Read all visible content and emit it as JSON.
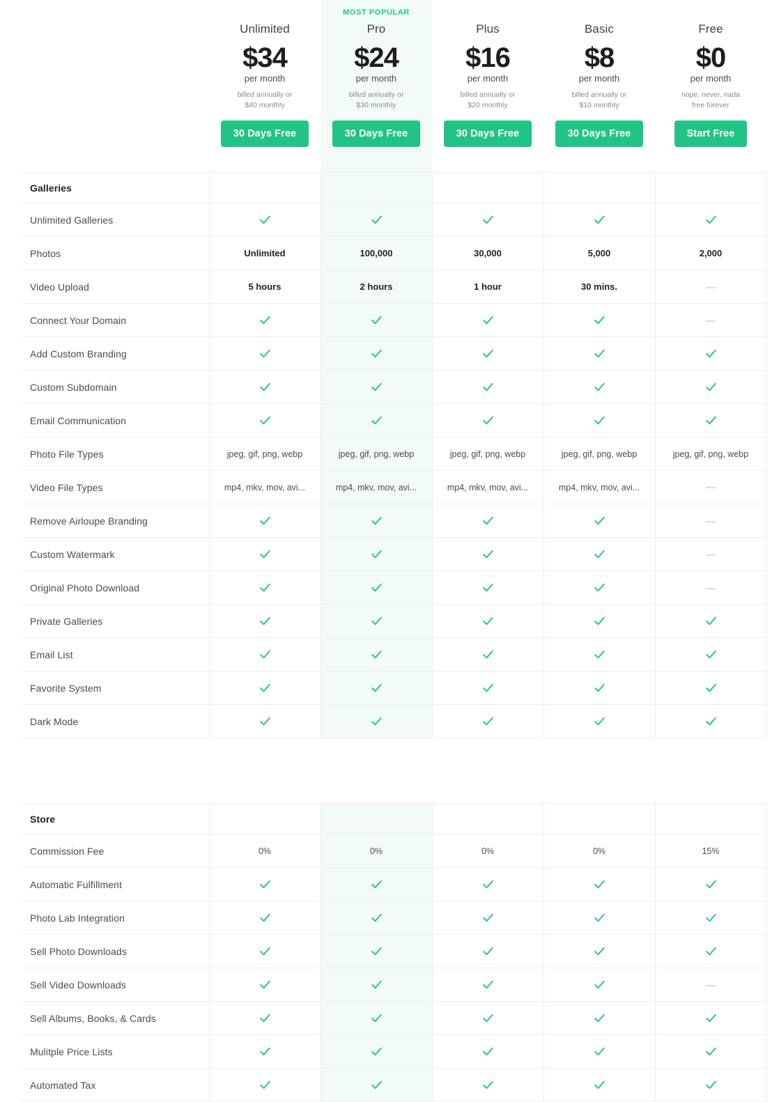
{
  "accent_color": "#22c486",
  "highlight_bg": "#f3fbf7",
  "border_color": "#ededed",
  "plans": [
    {
      "name": "Unlimited",
      "popular_label": "",
      "price": "$34",
      "per": "per month",
      "note_line1": "billed annually or",
      "note_line2": "$40 monthly",
      "cta": "30 Days Free",
      "highlight": false
    },
    {
      "name": "Pro",
      "popular_label": "MOST POPULAR",
      "price": "$24",
      "per": "per month",
      "note_line1": "billed annually or",
      "note_line2": "$30 monthly",
      "cta": "30 Days Free",
      "highlight": true
    },
    {
      "name": "Plus",
      "popular_label": "",
      "price": "$16",
      "per": "per month",
      "note_line1": "billed annually or",
      "note_line2": "$20 monthly",
      "cta": "30 Days Free",
      "highlight": false
    },
    {
      "name": "Basic",
      "popular_label": "",
      "price": "$8",
      "per": "per month",
      "note_line1": "billed annually or",
      "note_line2": "$10 monthly",
      "cta": "30 Days Free",
      "highlight": false
    },
    {
      "name": "Free",
      "popular_label": "",
      "price": "$0",
      "per": "per month",
      "note_line1": "nope, never, nada",
      "note_line2": "free forever",
      "cta": "Start Free",
      "highlight": false
    }
  ],
  "sections": [
    {
      "title": "Galleries",
      "rows": [
        {
          "label": "Unlimited Galleries",
          "values": [
            "check",
            "check",
            "check",
            "check",
            "check"
          ]
        },
        {
          "label": "Photos",
          "values": [
            "Unlimited",
            "100,000",
            "30,000",
            "5,000",
            "2,000"
          ],
          "bold": true
        },
        {
          "label": "Video Upload",
          "values": [
            "5 hours",
            "2 hours",
            "1 hour",
            "30 mins.",
            "dash"
          ],
          "bold": true
        },
        {
          "label": "Connect Your Domain",
          "values": [
            "check",
            "check",
            "check",
            "check",
            "dash"
          ]
        },
        {
          "label": "Add Custom Branding",
          "values": [
            "check",
            "check",
            "check",
            "check",
            "check"
          ]
        },
        {
          "label": "Custom Subdomain",
          "values": [
            "check",
            "check",
            "check",
            "check",
            "check"
          ]
        },
        {
          "label": "Email Communication",
          "values": [
            "check",
            "check",
            "check",
            "check",
            "check"
          ]
        },
        {
          "label": "Photo File Types",
          "values": [
            "jpeg, gif, png, webp",
            "jpeg, gif, png, webp",
            "jpeg, gif, png, webp",
            "jpeg, gif, png, webp",
            "jpeg, gif, png, webp"
          ],
          "plain": true
        },
        {
          "label": "Video File Types",
          "values": [
            "mp4, mkv, mov, avi...",
            "mp4, mkv, mov, avi...",
            "mp4, mkv, mov, avi...",
            "mp4, mkv, mov, avi...",
            "dash"
          ],
          "plain": true
        },
        {
          "label": "Remove Airloupe Branding",
          "values": [
            "check",
            "check",
            "check",
            "check",
            "dash"
          ]
        },
        {
          "label": "Custom Watermark",
          "values": [
            "check",
            "check",
            "check",
            "check",
            "dash"
          ]
        },
        {
          "label": "Original Photo Download",
          "values": [
            "check",
            "check",
            "check",
            "check",
            "dash"
          ]
        },
        {
          "label": "Private Galleries",
          "values": [
            "check",
            "check",
            "check",
            "check",
            "check"
          ]
        },
        {
          "label": "Email List",
          "values": [
            "check",
            "check",
            "check",
            "check",
            "check"
          ]
        },
        {
          "label": "Favorite System",
          "values": [
            "check",
            "check",
            "check",
            "check",
            "check"
          ]
        },
        {
          "label": "Dark Mode",
          "values": [
            "check",
            "check",
            "check",
            "check",
            "check"
          ]
        }
      ]
    },
    {
      "title": "Store",
      "rows": [
        {
          "label": "Commission Fee",
          "values": [
            "0%",
            "0%",
            "0%",
            "0%",
            "15%"
          ],
          "plain": true
        },
        {
          "label": "Automatic Fulfillment",
          "values": [
            "check",
            "check",
            "check",
            "check",
            "check"
          ]
        },
        {
          "label": "Photo Lab Integration",
          "values": [
            "check",
            "check",
            "check",
            "check",
            "check"
          ]
        },
        {
          "label": "Sell Photo Downloads",
          "values": [
            "check",
            "check",
            "check",
            "check",
            "check"
          ]
        },
        {
          "label": "Sell Video Downloads",
          "values": [
            "check",
            "check",
            "check",
            "check",
            "dash"
          ]
        },
        {
          "label": "Sell Albums, Books, & Cards",
          "values": [
            "check",
            "check",
            "check",
            "check",
            "check"
          ]
        },
        {
          "label": "Mulitple Price Lists",
          "values": [
            "check",
            "check",
            "check",
            "check",
            "check"
          ]
        },
        {
          "label": "Automated Tax",
          "values": [
            "check",
            "check",
            "check",
            "check",
            "check"
          ]
        }
      ]
    }
  ],
  "icons": {
    "check": "check-icon",
    "dash": "dash-icon"
  }
}
